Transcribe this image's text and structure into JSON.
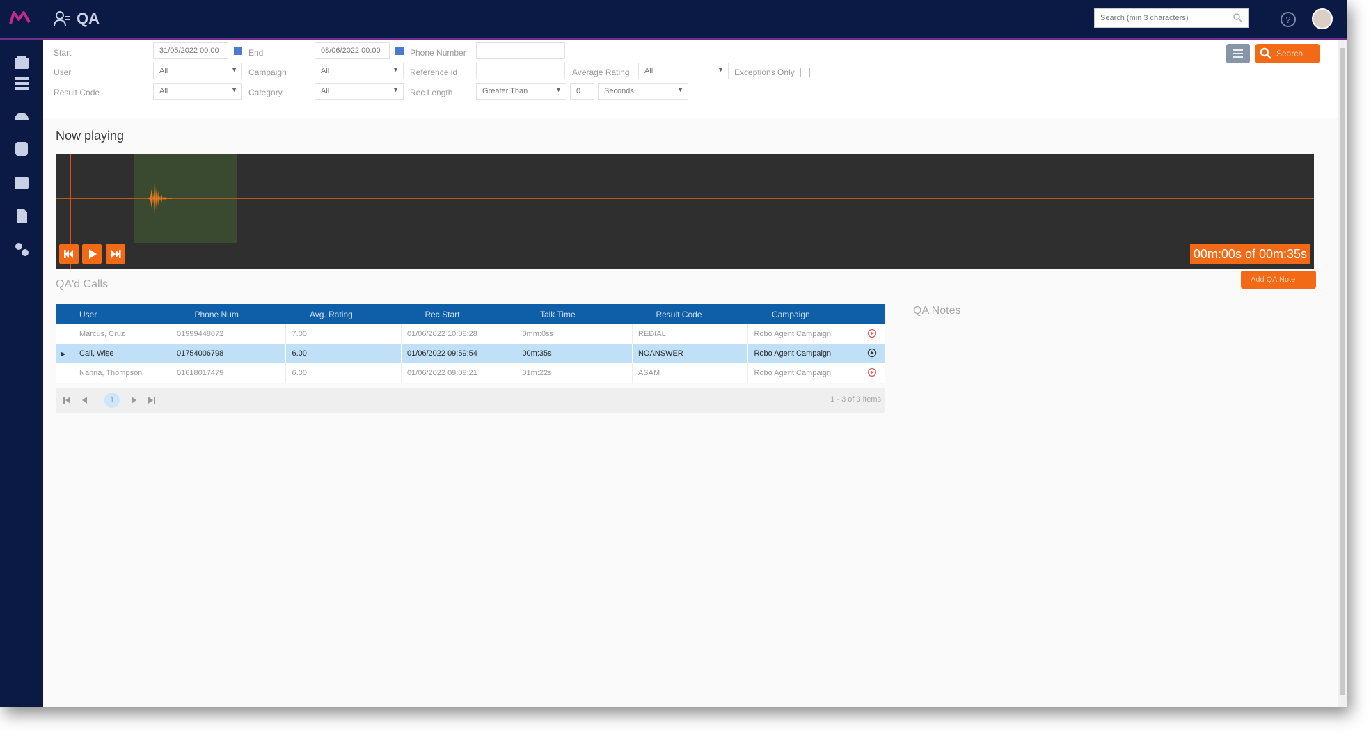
{
  "header": {
    "app_title": "QA",
    "search_placeholder": "Search (min 3 characters)"
  },
  "filters": {
    "start_label": "Start",
    "start_value": "31/05/2022 00:00",
    "end_label": "End",
    "end_value": "08/06/2022 00:00",
    "phone_label": "Phone Number",
    "phone_value": "",
    "user_label": "User",
    "user_value": "All",
    "campaign_label": "Campaign",
    "campaign_value": "All",
    "reference_label": "Reference id",
    "reference_value": "",
    "avg_rating_label": "Average Rating",
    "avg_rating_value": "All",
    "exceptions_label": "Exceptions Only",
    "result_code_label": "Result Code",
    "result_code_value": "All",
    "category_label": "Category",
    "category_value": "All",
    "rec_length_label": "Rec Length",
    "rec_length_op": "Greater Than",
    "rec_length_value": "0",
    "rec_length_unit": "Seconds",
    "search_button": "Search"
  },
  "player": {
    "title": "Now playing",
    "time": "00m:00s of 00m:35s"
  },
  "calls": {
    "title": "QA'd Calls",
    "add_note_button": "Add QA Note",
    "columns": [
      "User",
      "Phone Num",
      "Avg. Rating",
      "Rec Start",
      "Talk Time",
      "Result Code",
      "Campaign"
    ],
    "rows": [
      {
        "user": "Marcus, Cruz",
        "phone": "01999448072",
        "rating": "7.00",
        "start": "01/06/2022 10:08:28",
        "talk": "0mm:0ss",
        "result": "REDIAL",
        "campaign": "Robo Agent Campaign"
      },
      {
        "user": "Cali, Wise",
        "phone": "01754006798",
        "rating": "6.00",
        "start": "01/06/2022 09:59:54",
        "talk": "00m:35s",
        "result": "NOANSWER",
        "campaign": "Robo Agent Campaign"
      },
      {
        "user": "Nanna, Thompson",
        "phone": "01618017479",
        "rating": "6.00",
        "start": "01/06/2022 09:09:21",
        "talk": "01m:22s",
        "result": "ASAM",
        "campaign": "Robo Agent Campaign"
      }
    ],
    "pager": {
      "page": "1",
      "info": "1 - 3 of 3 items"
    }
  },
  "notes": {
    "title": "QA Notes"
  }
}
